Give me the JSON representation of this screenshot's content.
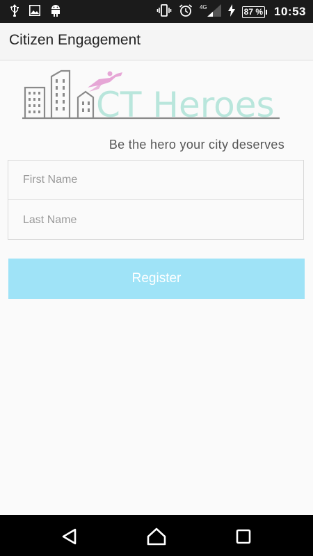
{
  "status_bar": {
    "left_icons": [
      "usb-icon",
      "image-icon",
      "android-icon"
    ],
    "right_icons": [
      "vibrate-icon",
      "alarm-icon",
      "signal-icon",
      "charging-icon"
    ],
    "network": "4G",
    "battery": "87 %",
    "time": "10:53"
  },
  "app_bar": {
    "title": "Citizen Engagement"
  },
  "logo": {
    "text": "CT Heroes",
    "tagline": "Be the hero your city deserves"
  },
  "form": {
    "first_name_placeholder": "First Name",
    "last_name_placeholder": "Last Name",
    "register_label": "Register"
  },
  "nav_bar": {
    "icons": [
      "back-icon",
      "home-icon",
      "recent-apps-icon"
    ]
  },
  "colors": {
    "accent_button": "#9fe3f7",
    "logo_text": "#b9e6dc",
    "hero_figure": "#e6a6d6",
    "city_lines": "#8a8a8a"
  }
}
